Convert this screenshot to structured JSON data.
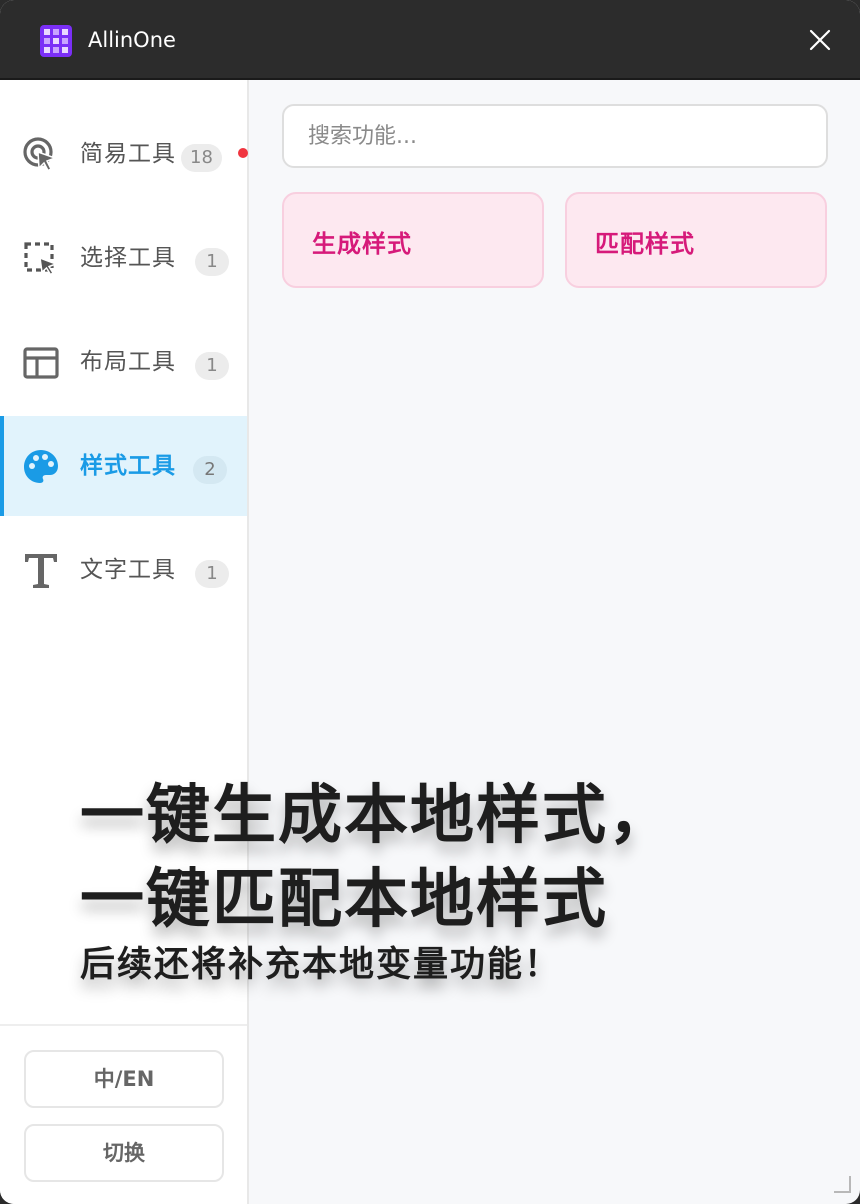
{
  "window": {
    "title": "AllinOne",
    "logo_icon": "grid-logo-icon",
    "close_icon": "close-icon"
  },
  "sidebar": {
    "items": [
      {
        "label": "简易工具",
        "badge": "18",
        "icon": "pointer-click-icon",
        "active": false,
        "has_dot": true
      },
      {
        "label": "选择工具",
        "badge": "1",
        "icon": "dashed-select-icon",
        "active": false,
        "has_dot": false
      },
      {
        "label": "布局工具",
        "badge": "1",
        "icon": "layout-icon",
        "active": false,
        "has_dot": false
      },
      {
        "label": "样式工具",
        "badge": "2",
        "icon": "palette-icon",
        "active": true,
        "has_dot": false
      },
      {
        "label": "文字工具",
        "badge": "1",
        "icon": "text-t-icon",
        "active": false,
        "has_dot": false
      }
    ],
    "lang_button": "中/EN",
    "switch_button": "切换"
  },
  "main": {
    "search": {
      "placeholder": "搜索功能...",
      "value": ""
    },
    "cards": [
      {
        "label": "生成样式"
      },
      {
        "label": "匹配样式"
      }
    ]
  },
  "overlay": {
    "line1": "一键生成本地样式，",
    "line2": "一键匹配本地样式",
    "line3": "后续还将补充本地变量功能！"
  },
  "colors": {
    "accent": "#1a9be6",
    "card_bg": "#fde8f0",
    "card_text": "#d61a7a",
    "titlebar": "#2c2c2c",
    "notification_dot": "#f0353f"
  }
}
